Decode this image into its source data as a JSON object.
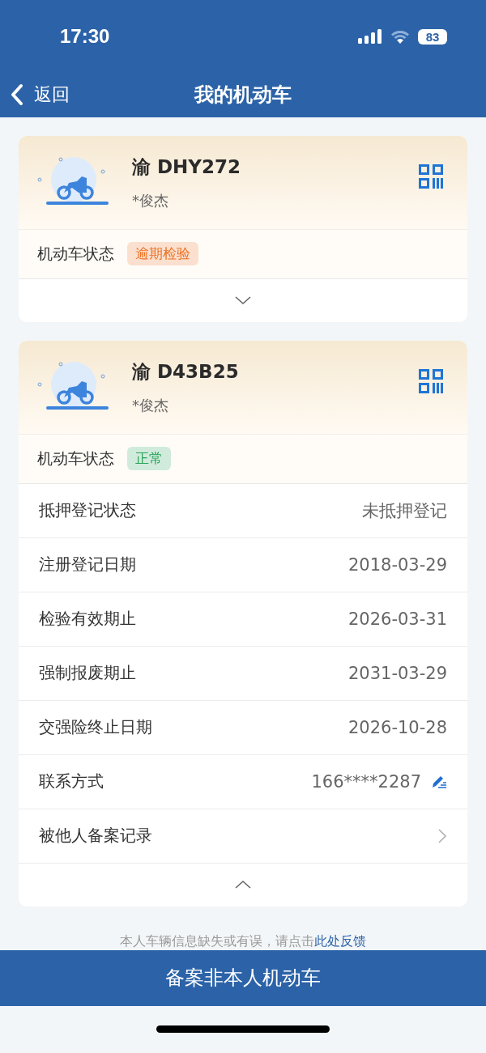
{
  "status_bar": {
    "time": "17:30",
    "battery": "83"
  },
  "nav": {
    "back": "返回",
    "title": "我的机动车"
  },
  "vehicles": [
    {
      "plate": "渝 DHY272",
      "owner": "*俊杰",
      "status_label": "机动车状态",
      "status": "逾期检验",
      "color": "#ec7326",
      "expanded": false
    },
    {
      "plate": "渝 D43B25",
      "owner": "*俊杰",
      "status_label": "机动车状态",
      "status": "正常",
      "color": "#2aa35a",
      "expanded": true,
      "details": [
        {
          "kind": "text",
          "label": "抵押登记状态",
          "value": "未抵押登记"
        },
        {
          "kind": "text",
          "label": "注册登记日期",
          "value": "2018-03-29"
        },
        {
          "kind": "text",
          "label": "检验有效期止",
          "value": "2026-03-31"
        },
        {
          "kind": "text",
          "label": "强制报废期止",
          "value": "2031-03-29"
        },
        {
          "kind": "text",
          "label": "交强险终止日期",
          "value": "2026-10-28"
        },
        {
          "kind": "edit",
          "label": "联系方式",
          "value": "166****2287"
        },
        {
          "kind": "link",
          "label": "被他人备案记录"
        }
      ]
    }
  ],
  "footer": {
    "text": "本人车辆信息缺失或有误，请点击",
    "link": "此处反馈"
  },
  "bottom_button": "备案非本人机动车"
}
